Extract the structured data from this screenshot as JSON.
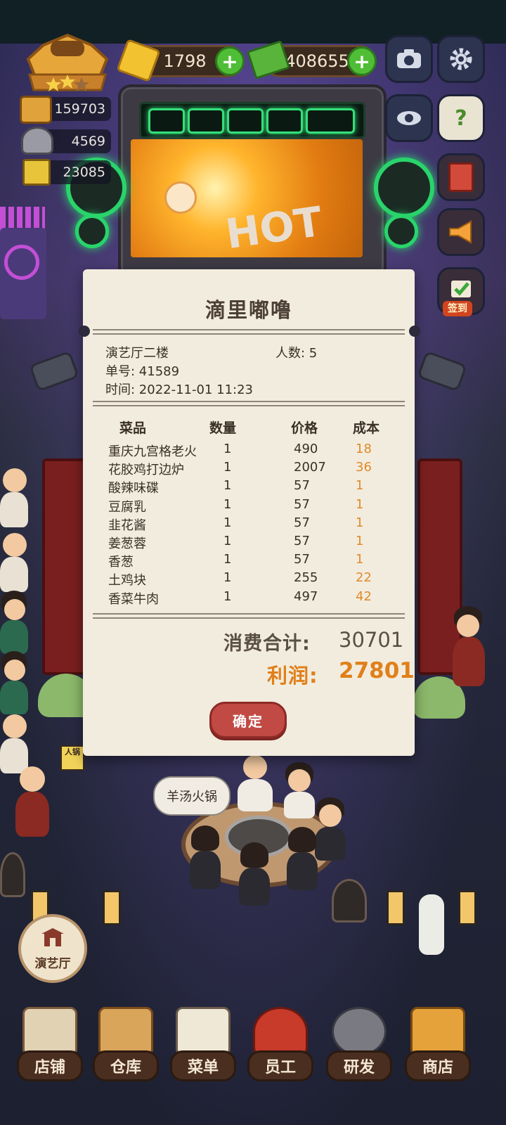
{
  "hud": {
    "gems": "1798",
    "cash": "408655",
    "stats": [
      "159703",
      "4569",
      "23085"
    ]
  },
  "side_buttons": {
    "sign_in_label": "签到"
  },
  "stage": {
    "screen_text": "HOT"
  },
  "receipt": {
    "title": "滴里嘟噜",
    "location": "演艺厅二楼",
    "guests_label": "人数",
    "guests_value": "5",
    "order_label": "单号",
    "order_value": "41589",
    "time_label": "时间",
    "time_value": "2022-11-01 11:23",
    "columns": [
      "菜品",
      "数量",
      "价格",
      "成本"
    ],
    "items": [
      {
        "name": "重庆九宫格老火",
        "qty": "1",
        "price": "490",
        "cost": "18"
      },
      {
        "name": "花胶鸡打边炉",
        "qty": "1",
        "price": "2007",
        "cost": "36"
      },
      {
        "name": "酸辣味碟",
        "qty": "1",
        "price": "57",
        "cost": "1"
      },
      {
        "name": "豆腐乳",
        "qty": "1",
        "price": "57",
        "cost": "1"
      },
      {
        "name": "韭花酱",
        "qty": "1",
        "price": "57",
        "cost": "1"
      },
      {
        "name": "姜葱蓉",
        "qty": "1",
        "price": "57",
        "cost": "1"
      },
      {
        "name": "香葱",
        "qty": "1",
        "price": "57",
        "cost": "1"
      },
      {
        "name": "土鸡块",
        "qty": "1",
        "price": "255",
        "cost": "22"
      },
      {
        "name": "香菜牛肉",
        "qty": "1",
        "price": "497",
        "cost": "42"
      }
    ],
    "total_label": "消费合计:",
    "total_value": "30701",
    "profit_label": "利润:",
    "profit_value": "27801",
    "confirm_label": "确定"
  },
  "scene": {
    "speech_bubble": "羊汤火锅",
    "location_button": "演艺厅",
    "delivery_sign": "人锅"
  },
  "bottom_nav": [
    "店铺",
    "仓库",
    "菜单",
    "员工",
    "研发",
    "商店"
  ],
  "colors": {
    "cost": "#e08a2a",
    "profit": "#e0801a",
    "confirm": "#c24a44",
    "plus": "#4fbe36",
    "neon": "#35e07a"
  }
}
